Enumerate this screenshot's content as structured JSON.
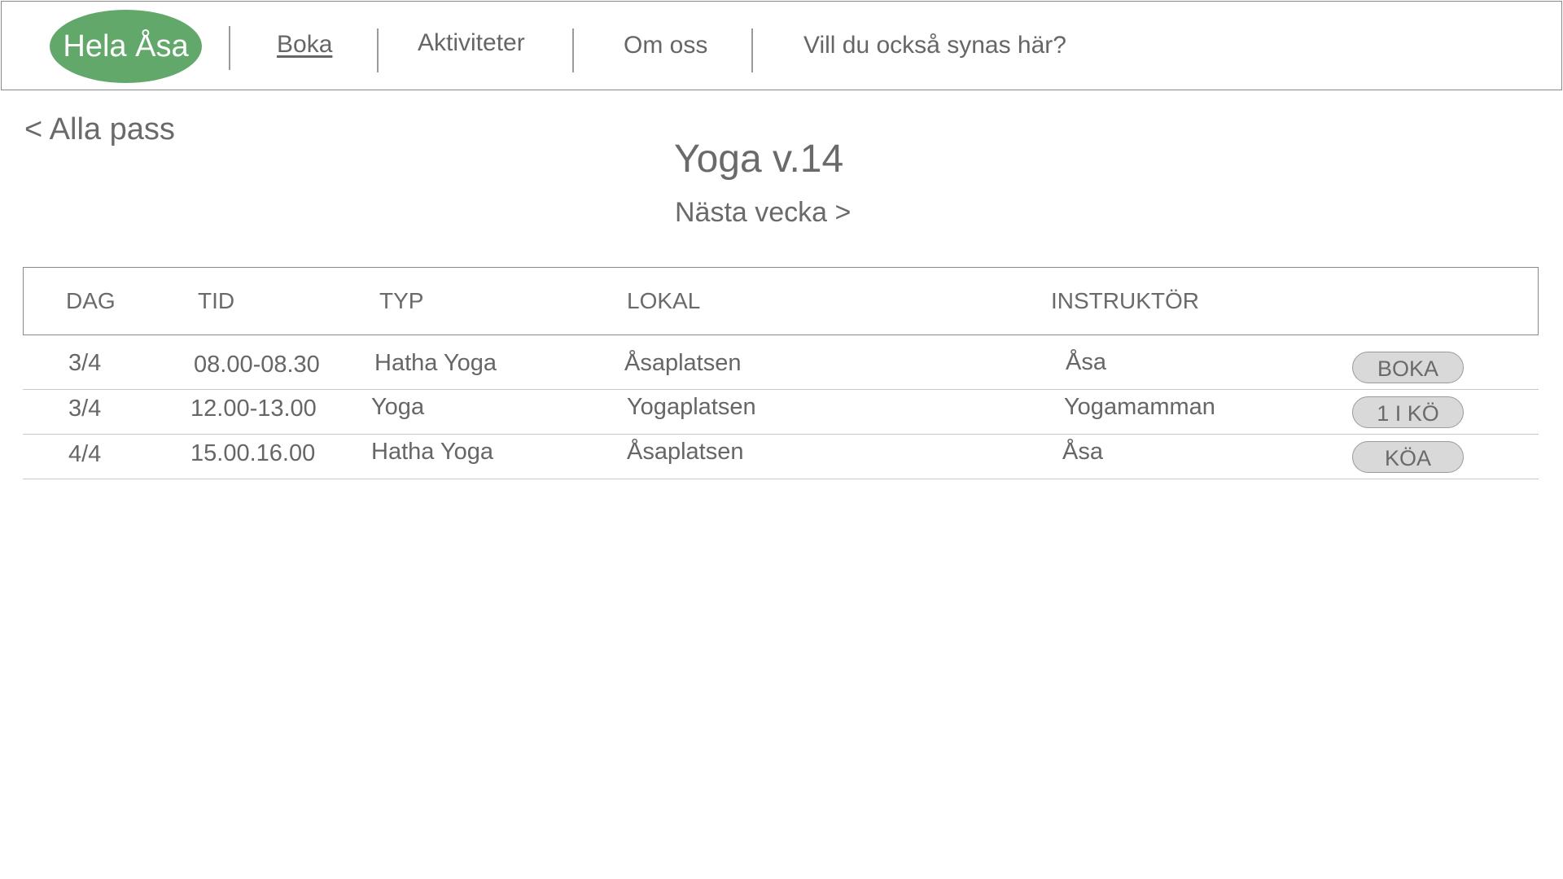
{
  "nav": {
    "logo": "Hela Åsa",
    "links": [
      "Boka",
      "Aktiviteter",
      "Om oss",
      "Vill du också synas här?"
    ]
  },
  "back_link": "< Alla pass",
  "title": "Yoga v.14",
  "next_week": "Nästa vecka >",
  "table": {
    "headers": [
      "DAG",
      "TID",
      "TYP",
      "LOKAL",
      "INSTRUKTÖR"
    ],
    "rows": [
      {
        "dag": "3/4",
        "tid": "08.00-08.30",
        "typ": "Hatha Yoga",
        "lokal": "Åsaplatsen",
        "instruktor": "Åsa",
        "action": "BOKA"
      },
      {
        "dag": "3/4",
        "tid": "12.00-13.00",
        "typ": "Yoga",
        "lokal": "Yogaplatsen",
        "instruktor": "Yogamamman",
        "action": "1 I KÖ"
      },
      {
        "dag": "4/4",
        "tid": "15.00.16.00",
        "typ": "Hatha Yoga",
        "lokal": "Åsaplatsen",
        "instruktor": "Åsa",
        "action": "KÖA"
      }
    ]
  },
  "colors": {
    "logo_bg": "#62a86a",
    "text": "#666666",
    "button_bg": "#d9d9d9"
  }
}
